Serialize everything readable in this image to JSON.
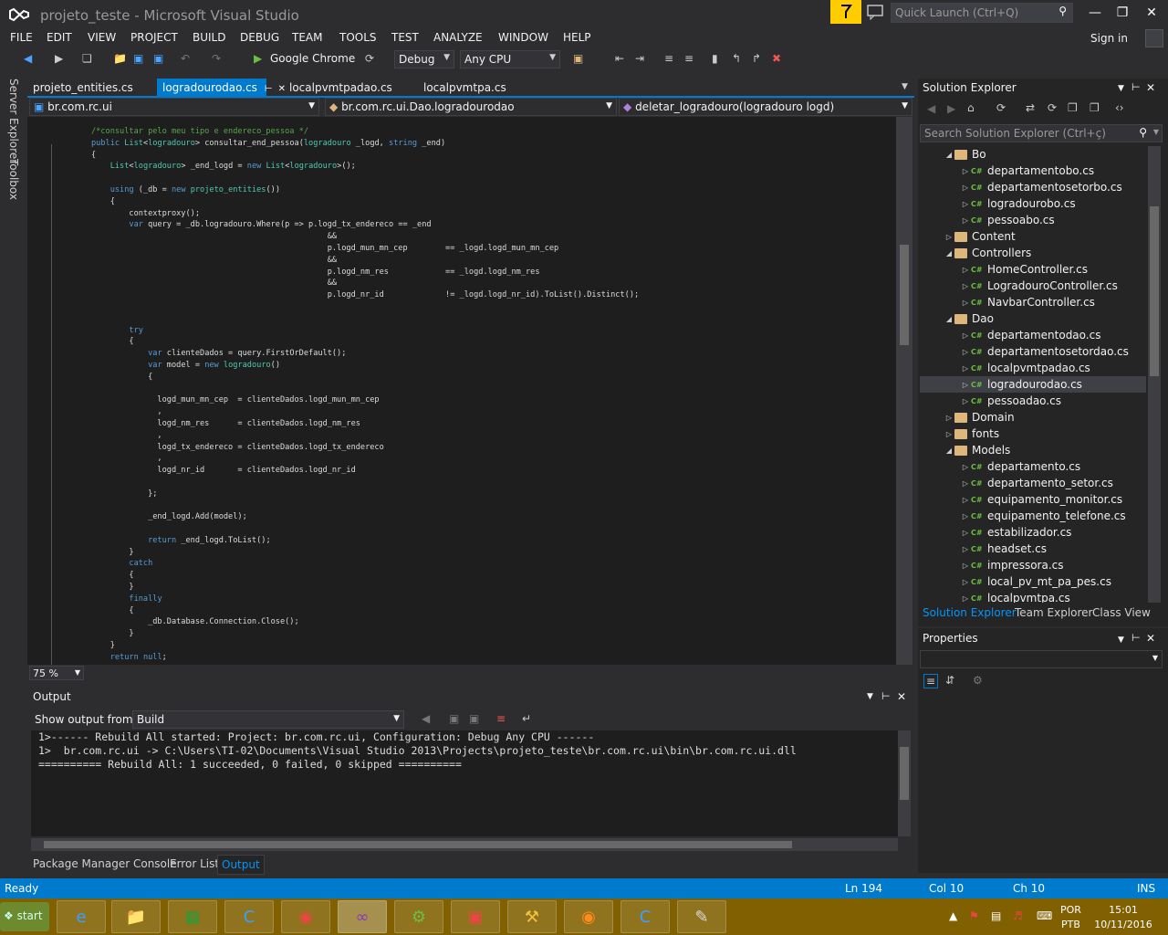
{
  "window": {
    "title": "projeto_teste - Microsoft Visual Studio",
    "quick_launch_placeholder": "Quick Launch (Ctrl+Q)"
  },
  "menu": [
    "FILE",
    "EDIT",
    "VIEW",
    "PROJECT",
    "BUILD",
    "DEBUG",
    "TEAM",
    "TOOLS",
    "TEST",
    "ANALYZE",
    "WINDOW",
    "HELP"
  ],
  "sign_in": "Sign in",
  "toolbar": {
    "run_target": "Google Chrome",
    "configuration": "Debug",
    "platform": "Any CPU"
  },
  "side_tabs": [
    "Server Explorer",
    "Toolbox"
  ],
  "doc_tabs": [
    "projeto_entities.cs",
    "logradourodao.cs",
    "localpvmtpadao.cs",
    "localpvmtpa.cs"
  ],
  "navbar": {
    "project": "br.com.rc.ui",
    "class": "br.com.rc.ui.Dao.logradourodao",
    "member": "deletar_logradouro(logradouro logd)"
  },
  "editor": {
    "zoom": "75 %"
  },
  "output": {
    "title": "Output",
    "show_from_label": "Show output from:",
    "source": "Build",
    "lines": [
      "1>------ Rebuild All started: Project: br.com.rc.ui, Configuration: Debug Any CPU ------",
      "1>  br.com.rc.ui -> C:\\Users\\TI-02\\Documents\\Visual Studio 2013\\Projects\\projeto_teste\\br.com.rc.ui\\bin\\br.com.rc.ui.dll",
      "========== Rebuild All: 1 succeeded, 0 failed, 0 skipped =========="
    ]
  },
  "bottom_tabs": [
    "Package Manager Console",
    "Error List",
    "Output"
  ],
  "solution_explorer": {
    "title": "Solution Explorer",
    "search_placeholder": "Search Solution Explorer (Ctrl+ç)",
    "tree": [
      {
        "label": "Bo",
        "type": "folder",
        "level": 0,
        "expanded": true
      },
      {
        "label": "departamentobo.cs",
        "type": "cs",
        "level": 1
      },
      {
        "label": "departamentosetorbo.cs",
        "type": "cs",
        "level": 1
      },
      {
        "label": "logradourobo.cs",
        "type": "cs",
        "level": 1
      },
      {
        "label": "pessoabo.cs",
        "type": "cs",
        "level": 1
      },
      {
        "label": "Content",
        "type": "folder",
        "level": 0,
        "expanded": false
      },
      {
        "label": "Controllers",
        "type": "folder",
        "level": 0,
        "expanded": true
      },
      {
        "label": "HomeController.cs",
        "type": "cs",
        "level": 1
      },
      {
        "label": "LogradouroController.cs",
        "type": "cs",
        "level": 1
      },
      {
        "label": "NavbarController.cs",
        "type": "cs",
        "level": 1
      },
      {
        "label": "Dao",
        "type": "folder",
        "level": 0,
        "expanded": true
      },
      {
        "label": "departamentodao.cs",
        "type": "cs",
        "level": 1
      },
      {
        "label": "departamentosetordao.cs",
        "type": "cs",
        "level": 1
      },
      {
        "label": "localpvmtpadao.cs",
        "type": "cs",
        "level": 1
      },
      {
        "label": "logradourodao.cs",
        "type": "cs",
        "level": 1,
        "selected": true
      },
      {
        "label": "pessoadao.cs",
        "type": "cs",
        "level": 1
      },
      {
        "label": "Domain",
        "type": "folder",
        "level": 0,
        "expanded": false
      },
      {
        "label": "fonts",
        "type": "folder",
        "level": 0,
        "expanded": false
      },
      {
        "label": "Models",
        "type": "folder",
        "level": 0,
        "expanded": true
      },
      {
        "label": "departamento.cs",
        "type": "cs",
        "level": 1
      },
      {
        "label": "departamento_setor.cs",
        "type": "cs",
        "level": 1
      },
      {
        "label": "equipamento_monitor.cs",
        "type": "cs",
        "level": 1
      },
      {
        "label": "equipamento_telefone.cs",
        "type": "cs",
        "level": 1
      },
      {
        "label": "estabilizador.cs",
        "type": "cs",
        "level": 1
      },
      {
        "label": "headset.cs",
        "type": "cs",
        "level": 1
      },
      {
        "label": "impressora.cs",
        "type": "cs",
        "level": 1
      },
      {
        "label": "local_pv_mt_pa_pes.cs",
        "type": "cs",
        "level": 1
      },
      {
        "label": "localpvmtpa.cs",
        "type": "cs",
        "level": 1
      }
    ],
    "tabs": [
      "Solution Explorer",
      "Team Explorer",
      "Class View"
    ]
  },
  "properties": {
    "title": "Properties"
  },
  "status": {
    "state": "Ready",
    "line": "Ln 194",
    "col": "Col 10",
    "ch": "Ch 10",
    "mode": "INS"
  },
  "taskbar": {
    "start": "start",
    "lang_top": "POR",
    "lang_bottom": "PTB",
    "time": "15:01",
    "date": "10/11/2016"
  },
  "colors": {
    "accent": "#007acc",
    "background": "#2d2d30",
    "editor": "#1e1e1e",
    "taskbar": "#806000",
    "notification": "#ffcc00"
  }
}
